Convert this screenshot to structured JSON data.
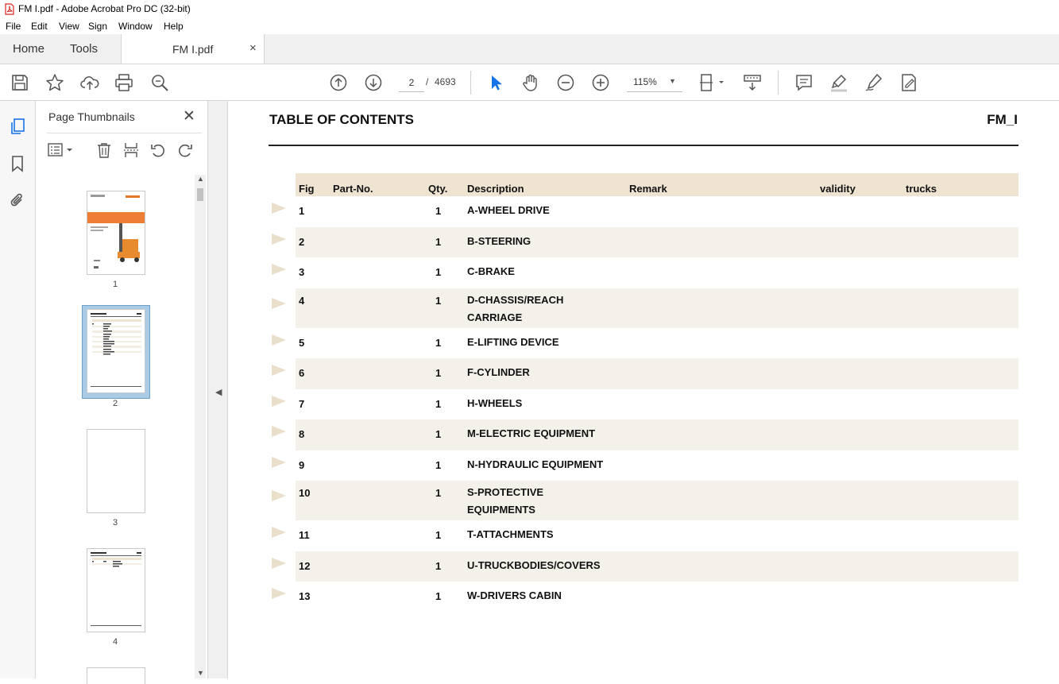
{
  "window": {
    "title": "FM I.pdf - Adobe Acrobat Pro DC (32-bit)"
  },
  "menu": [
    "File",
    "Edit",
    "View",
    "Sign",
    "Window",
    "Help"
  ],
  "tabs": {
    "home": "Home",
    "tools": "Tools",
    "document": "FM I.pdf",
    "close_glyph": "×"
  },
  "toolbar": {
    "page_current": "2",
    "page_separator": "/",
    "page_total": "4693",
    "zoom": "115%"
  },
  "thumbnails_panel": {
    "title": "Page Thumbnails",
    "close_glyph": "✕",
    "pages": [
      {
        "label": "1"
      },
      {
        "label": "2",
        "selected": true
      },
      {
        "label": "3"
      },
      {
        "label": "4"
      }
    ]
  },
  "document": {
    "title": "TABLE OF CONTENTS",
    "code": "FM_I",
    "columns": {
      "fig": "Fig",
      "part_no": "Part-No.",
      "qty": "Qty.",
      "description": "Description",
      "remark": "Remark",
      "validity": "validity",
      "trucks": "trucks"
    },
    "rows": [
      {
        "fig": "1",
        "qty": "1",
        "desc1": "A-WHEEL DRIVE",
        "desc2": ""
      },
      {
        "fig": "2",
        "qty": "1",
        "desc1": "B-STEERING",
        "desc2": ""
      },
      {
        "fig": "3",
        "qty": "1",
        "desc1": "C-BRAKE",
        "desc2": ""
      },
      {
        "fig": "4",
        "qty": "1",
        "desc1": "D-CHASSIS/REACH",
        "desc2": "CARRIAGE"
      },
      {
        "fig": "5",
        "qty": "1",
        "desc1": "E-LIFTING DEVICE",
        "desc2": ""
      },
      {
        "fig": "6",
        "qty": "1",
        "desc1": "F-CYLINDER",
        "desc2": ""
      },
      {
        "fig": "7",
        "qty": "1",
        "desc1": "H-WHEELS",
        "desc2": ""
      },
      {
        "fig": "8",
        "qty": "1",
        "desc1": "M-ELECTRIC EQUIPMENT",
        "desc2": ""
      },
      {
        "fig": "9",
        "qty": "1",
        "desc1": "N-HYDRAULIC EQUIPMENT",
        "desc2": ""
      },
      {
        "fig": "10",
        "qty": "1",
        "desc1": "S-PROTECTIVE",
        "desc2": "EQUIPMENTS"
      },
      {
        "fig": "11",
        "qty": "1",
        "desc1": "T-ATTACHMENTS",
        "desc2": ""
      },
      {
        "fig": "12",
        "qty": "1",
        "desc1": "U-TRUCKBODIES/COVERS",
        "desc2": ""
      },
      {
        "fig": "13",
        "qty": "1",
        "desc1": "W-DRIVERS CABIN",
        "desc2": ""
      }
    ]
  },
  "colors": {
    "header_bg": "#efe4d1",
    "row_stripe": "#f4f1ea",
    "marker": "#e9dfcb",
    "accent_blue": "#1473e6"
  }
}
